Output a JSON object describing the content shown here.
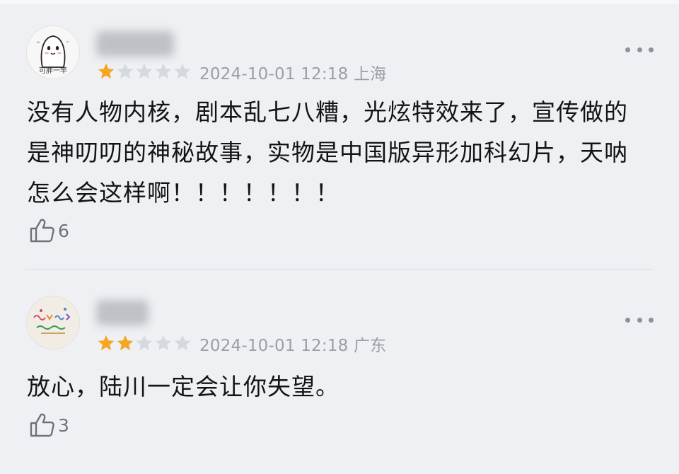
{
  "reviews": [
    {
      "avatar_caption": "可胖一竿",
      "rating": 1,
      "max_rating": 5,
      "timestamp": "2024-10-01 12:18",
      "location": "上海",
      "content": "没有人物内核，剧本乱七八糟，光炫特效来了，宣传做的是神叨叨的神秘故事，实物是中国版异形加科幻片，天呐怎么会这样啊！！！！！！！",
      "like_count": "6"
    },
    {
      "avatar_caption": "",
      "rating": 2,
      "max_rating": 5,
      "timestamp": "2024-10-01 12:18",
      "location": "广东",
      "content": "放心，陆川一定会让你失望。",
      "like_count": "3"
    }
  ],
  "colors": {
    "star_filled": "#f5a623",
    "star_empty": "#d5d8dd",
    "meta_text": "#9a9ea6",
    "background": "#eef0f3"
  },
  "icons": {
    "more": "more-dots-icon",
    "like": "thumbs-up-icon",
    "star": "star-icon"
  }
}
